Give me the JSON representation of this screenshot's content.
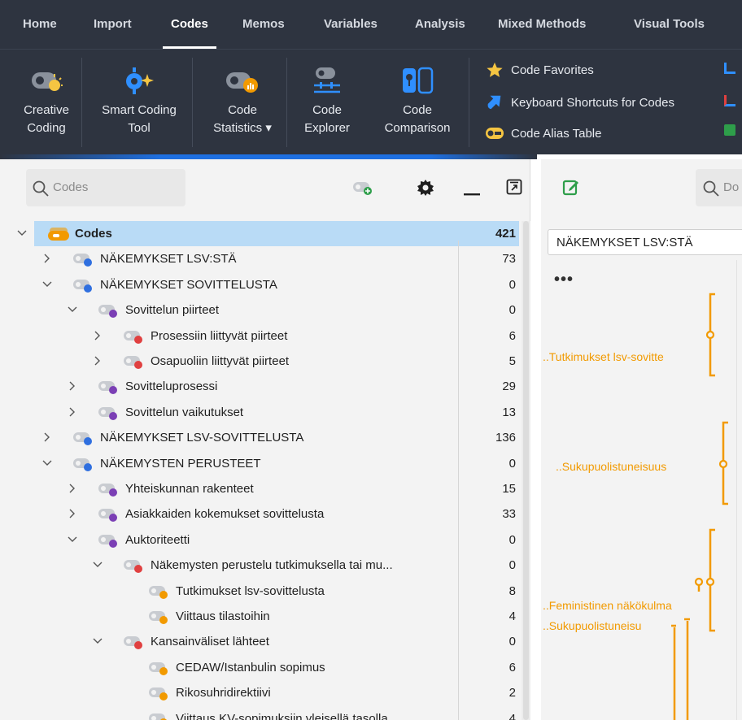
{
  "menu": {
    "tabs": [
      {
        "label": "Home",
        "active": false
      },
      {
        "label": "Import",
        "active": false
      },
      {
        "label": "Codes",
        "active": true
      },
      {
        "label": "Memos",
        "active": false
      },
      {
        "label": "Variables",
        "active": false
      },
      {
        "label": "Analysis",
        "active": false
      },
      {
        "label": "Mixed Methods",
        "active": false
      },
      {
        "label": "Visual Tools",
        "active": false
      }
    ]
  },
  "ribbon": {
    "buttons": [
      {
        "line1": "Creative",
        "line2": "Coding",
        "icon": "creative-coding-icon"
      },
      {
        "line1": "Smart Coding",
        "line2": "Tool",
        "icon": "smart-coding-icon"
      },
      {
        "line1": "Code",
        "line2": "Statistics ▾",
        "icon": "code-statistics-icon"
      },
      {
        "line1": "Code",
        "line2": "Explorer",
        "icon": "code-explorer-icon"
      },
      {
        "line1": "Code",
        "line2": "Comparison",
        "icon": "code-comparison-icon"
      }
    ],
    "links": [
      {
        "label": "Code Favorites",
        "icon": "star-icon"
      },
      {
        "label": "Keyboard Shortcuts for Codes",
        "icon": "shortcut-arrow-icon"
      },
      {
        "label": "Code Alias Table",
        "icon": "alias-table-icon"
      }
    ]
  },
  "codes_panel": {
    "search_placeholder": "Codes",
    "rows": [
      {
        "label": "Codes",
        "count": "421",
        "level": 0,
        "expanded": true,
        "dot": "",
        "bold": true,
        "root": true
      },
      {
        "label": "NÄKEMYKSET LSV:STÄ",
        "count": "73",
        "level": 1,
        "expanded": false,
        "dot": "#2f6fdf"
      },
      {
        "label": "NÄKEMYKSET SOVITTELUSTA",
        "count": "0",
        "level": 1,
        "expanded": true,
        "dot": "#2f6fdf"
      },
      {
        "label": "Sovittelun piirteet",
        "count": "0",
        "level": 2,
        "expanded": true,
        "dot": "#7b3fb5"
      },
      {
        "label": "Prosessiin liittyvät piirteet",
        "count": "6",
        "level": 3,
        "expanded": false,
        "dot": "#e04040"
      },
      {
        "label": "Osapuoliin liittyvät piirteet",
        "count": "5",
        "level": 3,
        "expanded": false,
        "dot": "#e04040"
      },
      {
        "label": "Sovitteluprosessi",
        "count": "29",
        "level": 2,
        "expanded": false,
        "dot": "#7b3fb5"
      },
      {
        "label": "Sovittelun vaikutukset",
        "count": "13",
        "level": 2,
        "expanded": false,
        "dot": "#7b3fb5"
      },
      {
        "label": "NÄKEMYKSET LSV-SOVITTELUSTA",
        "count": "136",
        "level": 1,
        "expanded": false,
        "dot": "#2f6fdf"
      },
      {
        "label": "NÄKEMYSTEN PERUSTEET",
        "count": "0",
        "level": 1,
        "expanded": true,
        "dot": "#2f6fdf"
      },
      {
        "label": "Yhteiskunnan rakenteet",
        "count": "15",
        "level": 2,
        "expanded": false,
        "dot": "#7b3fb5"
      },
      {
        "label": "Asiakkaiden kokemukset sovittelusta",
        "count": "33",
        "level": 2,
        "expanded": false,
        "dot": "#7b3fb5"
      },
      {
        "label": "Auktoriteetti",
        "count": "0",
        "level": 2,
        "expanded": true,
        "dot": "#7b3fb5"
      },
      {
        "label": "Näkemysten perustelu tutkimuksella tai mu...",
        "count": "0",
        "level": 3,
        "expanded": true,
        "dot": "#e04040"
      },
      {
        "label": "Tutkimukset lsv-sovittelusta",
        "count": "8",
        "level": 4,
        "expanded": null,
        "dot": "#f29a00"
      },
      {
        "label": "Viittaus tilastoihin",
        "count": "4",
        "level": 4,
        "expanded": null,
        "dot": "#f29a00"
      },
      {
        "label": "Kansainväliset lähteet",
        "count": "0",
        "level": 3,
        "expanded": true,
        "dot": "#e04040"
      },
      {
        "label": "CEDAW/Istanbulin sopimus",
        "count": "6",
        "level": 4,
        "expanded": null,
        "dot": "#f29a00"
      },
      {
        "label": "Rikosuhridirektiivi",
        "count": "2",
        "level": 4,
        "expanded": null,
        "dot": "#f29a00"
      },
      {
        "label": "Viittaus KV-sopimuksiin yleisellä tasolla",
        "count": "4",
        "level": 4,
        "expanded": null,
        "dot": "#f29a00"
      }
    ]
  },
  "document_panel": {
    "search_placeholder": "Do",
    "selected_code": "NÄKEMYKSET LSV:STÄ",
    "more_label": "•••",
    "annotations": [
      {
        "label": "..Tutkimukset lsv-sovitte"
      },
      {
        "label": "..Sukupuolistuneisuus"
      },
      {
        "label": "..Feministinen näkökulma"
      },
      {
        "label": "..Sukupuolistuneisu"
      }
    ]
  },
  "colors": {
    "menubar": "#2e3440",
    "accent": "#1e6fe0",
    "selection": "#b9dbf6",
    "orange": "#f29a00"
  }
}
